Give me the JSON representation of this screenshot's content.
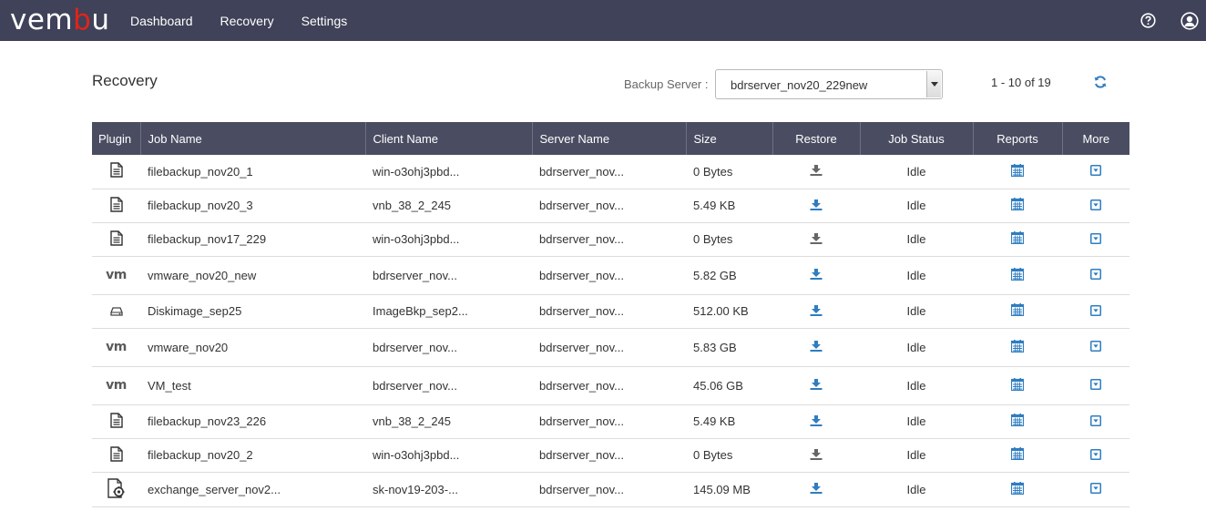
{
  "brand": {
    "logo_prefix": "vem",
    "logo_accent": "b",
    "logo_suffix": "u",
    "accent_color": "#e2231a"
  },
  "nav": {
    "items": [
      {
        "label": "Dashboard"
      },
      {
        "label": "Recovery"
      },
      {
        "label": "Settings"
      }
    ]
  },
  "top_icons": [
    "help-icon",
    "user-account-icon"
  ],
  "page": {
    "title": "Recovery"
  },
  "backup_server": {
    "label": "Backup Server :",
    "value": "bdrserver_nov20_229new"
  },
  "pager": {
    "text": "1 - 10 of 19"
  },
  "table": {
    "columns": [
      "Plugin",
      "Job Name",
      "Client Name",
      "Server Name",
      "Size",
      "Restore",
      "Job Status",
      "Reports",
      "More"
    ],
    "rows": [
      {
        "plugin": "file",
        "job": "filebackup_nov20_1",
        "client": "win-o3ohj3pbd...",
        "server": "bdrserver_nov...",
        "size": "0 Bytes",
        "restore_enabled": false,
        "status": "Idle"
      },
      {
        "plugin": "file",
        "job": "filebackup_nov20_3",
        "client": "vnb_38_2_245",
        "server": "bdrserver_nov...",
        "size": "5.49 KB",
        "restore_enabled": true,
        "status": "Idle"
      },
      {
        "plugin": "file",
        "job": "filebackup_nov17_229",
        "client": "win-o3ohj3pbd...",
        "server": "bdrserver_nov...",
        "size": "0 Bytes",
        "restore_enabled": false,
        "status": "Idle"
      },
      {
        "plugin": "vm",
        "job": "vmware_nov20_new",
        "client": "bdrserver_nov...",
        "server": "bdrserver_nov...",
        "size": "5.82 GB",
        "restore_enabled": true,
        "status": "Idle"
      },
      {
        "plugin": "disk",
        "job": "Diskimage_sep25",
        "client": "ImageBkp_sep2...",
        "server": "bdrserver_nov...",
        "size": "512.00 KB",
        "restore_enabled": true,
        "status": "Idle"
      },
      {
        "plugin": "vm",
        "job": "vmware_nov20",
        "client": "bdrserver_nov...",
        "server": "bdrserver_nov...",
        "size": "5.83 GB",
        "restore_enabled": true,
        "status": "Idle"
      },
      {
        "plugin": "vm",
        "job": "VM_test",
        "client": "bdrserver_nov...",
        "server": "bdrserver_nov...",
        "size": "45.06 GB",
        "restore_enabled": true,
        "status": "Idle"
      },
      {
        "plugin": "file",
        "job": "filebackup_nov23_226",
        "client": "vnb_38_2_245",
        "server": "bdrserver_nov...",
        "size": "5.49 KB",
        "restore_enabled": true,
        "status": "Idle"
      },
      {
        "plugin": "file",
        "job": "filebackup_nov20_2",
        "client": "win-o3ohj3pbd...",
        "server": "bdrserver_nov...",
        "size": "0 Bytes",
        "restore_enabled": false,
        "status": "Idle"
      },
      {
        "plugin": "exchange",
        "job": "exchange_server_nov2...",
        "client": "sk-nov19-203-...",
        "server": "bdrserver_nov...",
        "size": "145.09 MB",
        "restore_enabled": true,
        "status": "Idle"
      }
    ]
  },
  "colors": {
    "nav_bg": "#3f4258",
    "header_bg": "#4a4d62",
    "icon_blue": "#2f7dc0",
    "icon_gray": "#666666"
  },
  "vm_icon_text": "vm"
}
